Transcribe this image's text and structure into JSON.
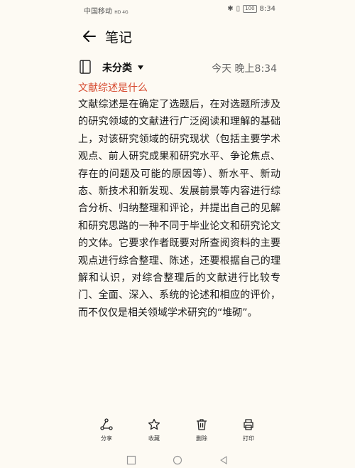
{
  "status": {
    "carrier": "中国移动",
    "net": "HD 4G",
    "battery": "100",
    "time": "8:34"
  },
  "header": {
    "title": "笔记"
  },
  "meta": {
    "category": "未分类",
    "timestamp": "今天 晚上8:34"
  },
  "note": {
    "title": "文献综述是什么",
    "body": "文献综述是在确定了选题后，在对选题所涉及的研究领域的文献进行广泛阅读和理解的基础上，对该研究领域的研究现状（包括主要学术观点、前人研究成果和研究水平、争论焦点、存在的问题及可能的原因等）、新水平、新动态、新技术和新发现、发展前景等内容进行综合分析、归纳整理和评论，并提出自己的见解和研究思路的一种不同于毕业论文和研究论文的文体。它要求作者既要对所查阅资料的主要观点进行综合整理、陈述，还要根据自己的理解和认识，对综合整理后的文献进行比较专门、全面、深入、系统的论述和相应的评价，而不仅仅是相关领域学术研究的“堆砌”。"
  },
  "actions": {
    "share": "分享",
    "favorite": "收藏",
    "delete": "删除",
    "print": "打印"
  },
  "colors": {
    "accent": "#d64a2f",
    "background": "#fdfaf3"
  }
}
